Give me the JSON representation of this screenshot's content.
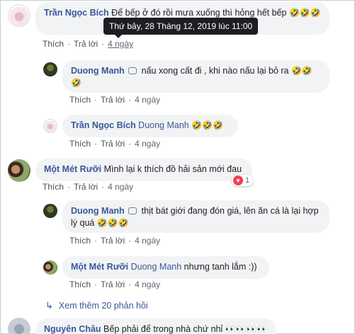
{
  "tooltip": "Thứ bảy, 28 Tháng 12, 2019 lúc 11:00",
  "like_label": "Thích",
  "reply_label": "Trả lời",
  "comments": [
    {
      "author": "Trần Ngọc Bích",
      "text": "Để bếp ở đó rồi mưa xuống thì hỏng hết bếp",
      "emoji": "🤣🤣🤣",
      "time": "4 ngày"
    },
    {
      "author": "Duong Manh",
      "text": "nấu xong cất đi , khi nào nấu lại bỏ ra",
      "emoji": "🤣🤣🤣",
      "time": "4 ngày",
      "icon": "chat-bubble-icon"
    },
    {
      "author": "Trần Ngọc Bích",
      "mention": "Duong Manh",
      "emoji": "🤣🤣🤣",
      "time": "4 ngày"
    },
    {
      "author": "Một Mét Rưỡi",
      "text": "Mình lại k thích đồ hải sản mới đau",
      "time": "4 ngày",
      "reaction_count": "1",
      "reaction_icon": "heart-icon"
    },
    {
      "author": "Duong Manh",
      "text": "thịt bát giới đang đón giá, lên ăn cá là lại hợp lý quá",
      "emoji": "🤣🤣🤣",
      "time": "4 ngày",
      "icon": "chat-bubble-icon"
    },
    {
      "author": "Một Mét Rưỡi",
      "mention": "Duong Manh",
      "text": "nhưng tanh lắm :))",
      "time": "4 ngày"
    },
    {
      "author": "Nguyên Châu",
      "text": "Bếp phải để trong nhà chứ nhỉ",
      "emoji": "👀👀👀👀"
    }
  ],
  "view_more": "Xem thêm 20 phản hồi",
  "colors": {
    "link": "#385898",
    "bubble": "#f2f3f5",
    "meta": "#606770",
    "heart": "#f33e58"
  }
}
